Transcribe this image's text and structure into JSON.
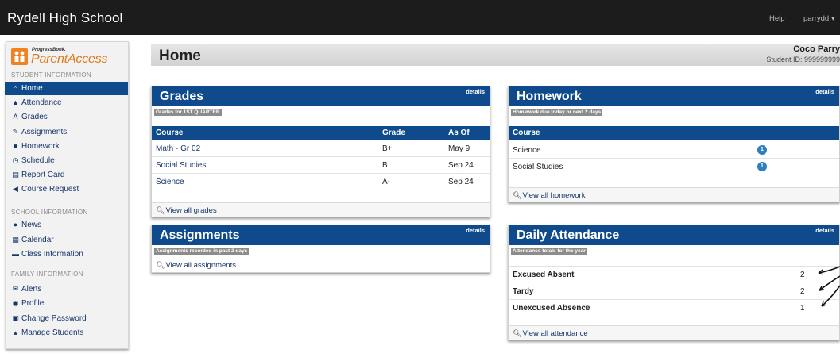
{
  "topbar": {
    "school_name": "Rydell High School",
    "help": "Help",
    "user": "parrydd ▾"
  },
  "logo": {
    "small": "ProgressBook.",
    "name": "ParentAccess"
  },
  "sidebar": {
    "student_header": "STUDENT INFORMATION",
    "student_items": [
      {
        "label": "Home",
        "icon": "home-icon",
        "glyph": "⌂"
      },
      {
        "label": "Attendance",
        "icon": "bell-icon",
        "glyph": "▲"
      },
      {
        "label": "Grades",
        "icon": "grade-letter-icon",
        "glyph": "A"
      },
      {
        "label": "Assignments",
        "icon": "edit-icon",
        "glyph": "✎"
      },
      {
        "label": "Homework",
        "icon": "book-icon",
        "glyph": "■"
      },
      {
        "label": "Schedule",
        "icon": "clock-icon",
        "glyph": "◷"
      },
      {
        "label": "Report Card",
        "icon": "report-card-icon",
        "glyph": "▤"
      },
      {
        "label": "Course Request",
        "icon": "bullhorn-icon",
        "glyph": "◀"
      }
    ],
    "school_header": "SCHOOL INFORMATION",
    "school_items": [
      {
        "label": "News",
        "icon": "globe-icon",
        "glyph": "●"
      },
      {
        "label": "Calendar",
        "icon": "calendar-icon",
        "glyph": "▦"
      },
      {
        "label": "Class Information",
        "icon": "comment-icon",
        "glyph": "▬"
      }
    ],
    "family_header": "FAMILY INFORMATION",
    "family_items": [
      {
        "label": "Alerts",
        "icon": "envelope-icon",
        "glyph": "✉"
      },
      {
        "label": "Profile",
        "icon": "info-icon",
        "glyph": "◉"
      },
      {
        "label": "Change Password",
        "icon": "lock-icon",
        "glyph": "▣"
      },
      {
        "label": "Manage Students",
        "icon": "user-icon",
        "glyph": "▴"
      }
    ]
  },
  "page": {
    "title": "Home",
    "student_name": "Coco Parry",
    "student_id": "Student ID: 999999999"
  },
  "grades": {
    "title": "Grades",
    "details": "details",
    "tag": "Grades for 1ST QUARTER",
    "columns": [
      "Course",
      "Grade",
      "As Of"
    ],
    "rows": [
      {
        "course": "Math - Gr 02",
        "grade": "B+",
        "as_of": "May 9"
      },
      {
        "course": "Social Studies",
        "grade": "B",
        "as_of": "Sep 24"
      },
      {
        "course": "Science",
        "grade": "A-",
        "as_of": "Sep 24"
      }
    ],
    "footer": "View all grades"
  },
  "assignments": {
    "title": "Assignments",
    "details": "details",
    "tag": "Assignments recorded in past 2 days",
    "footer": "View all assignments"
  },
  "homework": {
    "title": "Homework",
    "details": "details",
    "tag": "Homework due today or next 2 days",
    "columns": [
      "Course"
    ],
    "rows": [
      {
        "course": "Science",
        "count": "1"
      },
      {
        "course": "Social Studies",
        "count": "1"
      }
    ],
    "footer": "View all homework"
  },
  "attendance": {
    "title": "Daily Attendance",
    "details": "details",
    "tag": "Attendance totals for the year",
    "rows": [
      {
        "label": "Excused Absent",
        "value": "2"
      },
      {
        "label": "Tardy",
        "value": "2"
      },
      {
        "label": "Unexcused Absence",
        "value": "1"
      }
    ],
    "footer": "View all attendance"
  },
  "colors": {
    "brand_blue": "#0e4a8c",
    "topbar": "#1c1c1c",
    "logo_orange": "#f08222",
    "badge_blue": "#2e7fbf"
  }
}
